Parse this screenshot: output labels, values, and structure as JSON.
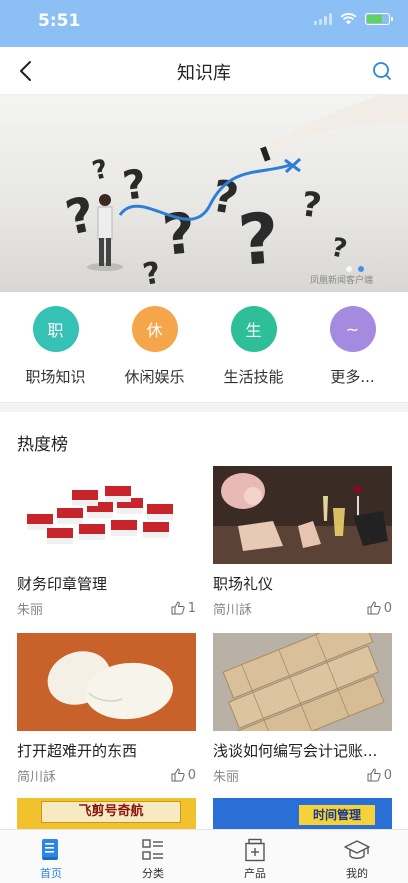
{
  "status_bar": {
    "time": "5:51",
    "battery_level": 0.7
  },
  "nav": {
    "title": "知识库"
  },
  "banner": {
    "watermark": "凤凰新闻客户端",
    "active_page": 2,
    "pages": 2
  },
  "categories": [
    {
      "glyph": "职",
      "label": "职场知识",
      "color": "#36c1b5"
    },
    {
      "glyph": "休",
      "label": "休闲娱乐",
      "color": "#f5a64a"
    },
    {
      "glyph": "生",
      "label": "生活技能",
      "color": "#2fbf98"
    },
    {
      "glyph": "~",
      "label": "更多...",
      "color": "#a58be0"
    }
  ],
  "hot": {
    "title": "热度榜",
    "items": [
      {
        "title": "财务印章管理",
        "author": "朱丽",
        "likes": "1"
      },
      {
        "title": "职场礼仪",
        "author": "简川訸",
        "likes": "0"
      },
      {
        "title": "打开超难开的东西",
        "author": "简川訸",
        "likes": "0"
      },
      {
        "title": "浅谈如何编写会计记账...",
        "author": "朱丽",
        "likes": "0"
      },
      {
        "title": "飞剪号奇航",
        "author": "",
        "likes": ""
      },
      {
        "title": "时间管理",
        "author": "",
        "likes": ""
      }
    ]
  },
  "tabs": [
    {
      "label": "首页",
      "icon": "book-icon",
      "active": true
    },
    {
      "label": "分类",
      "icon": "list-icon",
      "active": false
    },
    {
      "label": "产品",
      "icon": "product-icon",
      "active": false
    },
    {
      "label": "我的",
      "icon": "graduation-cap-icon",
      "active": false
    }
  ],
  "colors": {
    "accent": "#2b85e4",
    "status_bar": "#8cc0f5"
  }
}
